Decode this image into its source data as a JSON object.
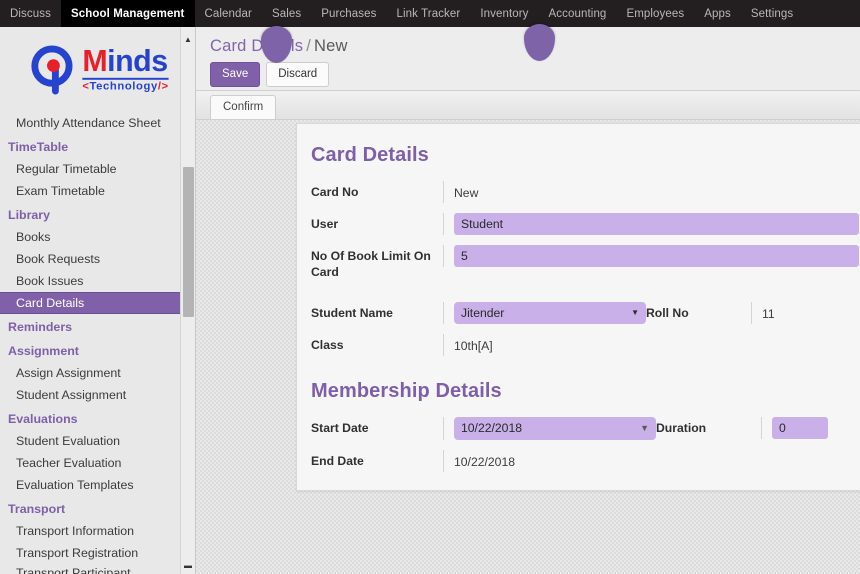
{
  "topnav": {
    "items": [
      {
        "label": "Discuss",
        "active": false
      },
      {
        "label": "School Management",
        "active": true
      },
      {
        "label": "Calendar",
        "active": false
      },
      {
        "label": "Sales",
        "active": false
      },
      {
        "label": "Purchases",
        "active": false
      },
      {
        "label": "Link Tracker",
        "active": false
      },
      {
        "label": "Inventory",
        "active": false
      },
      {
        "label": "Accounting",
        "active": false
      },
      {
        "label": "Employees",
        "active": false
      },
      {
        "label": "Apps",
        "active": false
      },
      {
        "label": "Settings",
        "active": false
      }
    ]
  },
  "logo": {
    "word_part1": "M",
    "word_part2": "inds",
    "sub_left": "<",
    "sub_text": "Technology",
    "sub_right": "/>",
    "colors": {
      "blue": "#2643cf",
      "red": "#e8202a"
    }
  },
  "sidebar": {
    "scroll": {
      "up_icon": "scroll-up-arrow",
      "down_icon": "scroll-down-arrow"
    },
    "menu": [
      {
        "type": "item",
        "label": "Monthly Attendance Sheet",
        "active": false
      },
      {
        "type": "group",
        "label": "TimeTable"
      },
      {
        "type": "item",
        "label": "Regular Timetable",
        "active": false
      },
      {
        "type": "item",
        "label": "Exam Timetable",
        "active": false
      },
      {
        "type": "group",
        "label": "Library"
      },
      {
        "type": "item",
        "label": "Books",
        "active": false
      },
      {
        "type": "item",
        "label": "Book Requests",
        "active": false
      },
      {
        "type": "item",
        "label": "Book Issues",
        "active": false
      },
      {
        "type": "item",
        "label": "Card Details",
        "active": true
      },
      {
        "type": "group",
        "label": "Reminders"
      },
      {
        "type": "group",
        "label": "Assignment"
      },
      {
        "type": "item",
        "label": "Assign Assignment",
        "active": false
      },
      {
        "type": "item",
        "label": "Student Assignment",
        "active": false
      },
      {
        "type": "group",
        "label": "Evaluations"
      },
      {
        "type": "item",
        "label": "Student Evaluation",
        "active": false
      },
      {
        "type": "item",
        "label": "Teacher Evaluation",
        "active": false
      },
      {
        "type": "item",
        "label": "Evaluation Templates",
        "active": false
      },
      {
        "type": "group",
        "label": "Transport"
      },
      {
        "type": "item",
        "label": "Transport Information",
        "active": false
      },
      {
        "type": "item",
        "label": "Transport Registration",
        "active": false
      },
      {
        "type": "item",
        "label": "Transport Participant",
        "active": false,
        "clipped": true
      }
    ]
  },
  "control_panel": {
    "breadcrumb_root": "Card Details",
    "breadcrumb_sep": "/",
    "breadcrumb_current": "New",
    "save_label": "Save",
    "discard_label": "Discard",
    "confirm_label": "Confirm"
  },
  "form": {
    "section1_title": "Card Details",
    "section2_title": "Membership Details",
    "card_no": {
      "label": "Card No",
      "value": "New"
    },
    "user": {
      "label": "User",
      "value": "Student"
    },
    "book_limit": {
      "label": "No Of Book Limit On Card",
      "value": "5"
    },
    "student_name": {
      "label": "Student Name",
      "value": "Jitender",
      "caret": "▼"
    },
    "roll_no": {
      "label": "Roll No",
      "value": "11"
    },
    "class": {
      "label": "Class",
      "value": "10th[A]"
    },
    "start_date": {
      "label": "Start Date",
      "value": "10/22/2018",
      "caret": "▼"
    },
    "duration": {
      "label": "Duration",
      "value": "0"
    },
    "end_date": {
      "label": "End Date",
      "value": "10/22/2018"
    }
  },
  "markers": [
    {
      "name": "cursor-pin-1",
      "color": "#7e63a8"
    },
    {
      "name": "cursor-pin-2",
      "color": "#7e63a8"
    }
  ]
}
